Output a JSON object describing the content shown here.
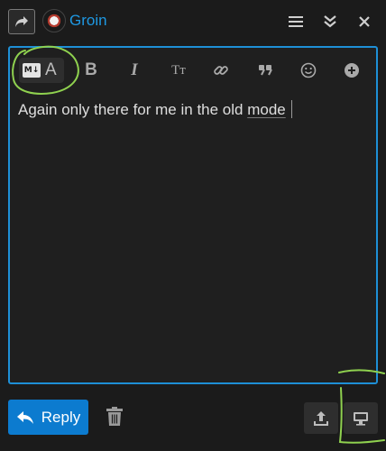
{
  "header": {
    "username": "Groin",
    "icons": [
      "share-reply-icon",
      "avatar",
      "hamburger-menu-icon",
      "collapse-double-chevron-icon",
      "close-icon"
    ]
  },
  "toolbar": {
    "mode_badge": "M↓",
    "mode_letter": "A",
    "bold": "B",
    "italic": "I",
    "heading": "Tт",
    "icons": [
      "markdown-icon",
      "bold-icon",
      "italic-icon",
      "heading-icon",
      "link-icon",
      "quote-icon",
      "emoji-icon",
      "add-icon"
    ]
  },
  "editor": {
    "text_before": "Again only there for me in the old ",
    "text_underlined": "mode"
  },
  "footer": {
    "reply_label": "Reply",
    "icons": [
      "reply-arrow-icon",
      "trash-icon",
      "upload-icon",
      "desktop-preview-icon"
    ]
  },
  "colors": {
    "accent": "#1e8fd6",
    "reply_bg": "#0c7bcf",
    "username": "#1e98e2",
    "annotation": "#8fd14f",
    "background": "#1b1b1b"
  }
}
